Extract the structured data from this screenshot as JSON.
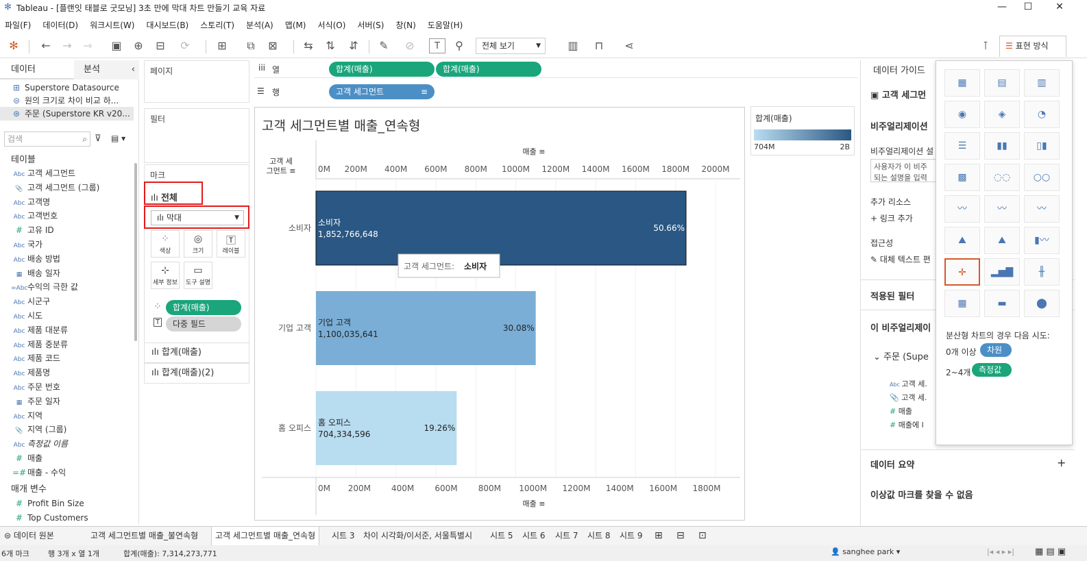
{
  "window": {
    "title": "Tableau - [플랜잇 태블로 굿모닝] 3초 만에 막대 차트 만들기 교육 자료"
  },
  "menu": [
    "파일(F)",
    "데이터(D)",
    "워크시트(W)",
    "대시보드(B)",
    "스토리(T)",
    "분석(A)",
    "맵(M)",
    "서식(O)",
    "서버(S)",
    "창(N)",
    "도움말(H)"
  ],
  "toolbar": {
    "view_select": "전체 보기",
    "show_me": "표현 방식"
  },
  "left": {
    "tab_data": "데이터",
    "tab_analysis": "분석",
    "sources": [
      "Superstore Datasource",
      "원의 크기로 차이 비교 하...",
      "주문 (Superstore KR v20..."
    ],
    "search_placeholder": "검색",
    "tables_header": "테이블",
    "fields": [
      {
        "icon": "Abc",
        "name": "고객 세그먼트"
      },
      {
        "icon": "📎",
        "name": "고객 세그먼트 (그룹)"
      },
      {
        "icon": "Abc",
        "name": "고객명"
      },
      {
        "icon": "Abc",
        "name": "고객번호"
      },
      {
        "icon": "#",
        "name": "고유 ID"
      },
      {
        "icon": "Abc",
        "name": "국가"
      },
      {
        "icon": "Abc",
        "name": "배송 방법"
      },
      {
        "icon": "▦",
        "name": "배송 일자"
      },
      {
        "icon": "=Abc",
        "name": "수익의 극한 값"
      },
      {
        "icon": "Abc",
        "name": "시군구"
      },
      {
        "icon": "Abc",
        "name": "시도"
      },
      {
        "icon": "Abc",
        "name": "제품 대분류"
      },
      {
        "icon": "Abc",
        "name": "제품 중분류"
      },
      {
        "icon": "Abc",
        "name": "제품 코드"
      },
      {
        "icon": "Abc",
        "name": "제품명"
      },
      {
        "icon": "Abc",
        "name": "주문 번호"
      },
      {
        "icon": "▦",
        "name": "주문 일자"
      },
      {
        "icon": "Abc",
        "name": "지역"
      },
      {
        "icon": "📎",
        "name": "지역 (그룹)"
      },
      {
        "icon": "Abc",
        "name": "측정값 이름"
      },
      {
        "icon": "#",
        "name": "매출"
      },
      {
        "icon": "=#",
        "name": "매출 - 수익"
      }
    ],
    "params_header": "매개 변수",
    "params": [
      "Profit Bin Size",
      "Top Customers"
    ]
  },
  "shelves": {
    "pages": "페이지",
    "filters": "필터",
    "marks": "마크",
    "marks_all": "전체",
    "mark_type": "막대",
    "buttons": [
      "색상",
      "크기",
      "레이블",
      "세부 정보",
      "도구 설명"
    ],
    "pill_color": "합계(매출)",
    "pill_multi": "다중 필드",
    "sub1": "합계(매출)",
    "sub2": "합계(매출)(2)"
  },
  "columns_label": "열",
  "rows_label": "행",
  "columns_pills": [
    "합계(매출)",
    "합계(매출)"
  ],
  "rows_pills": [
    "고객 세그먼트"
  ],
  "chart_data": {
    "type": "bar",
    "title": "고객 세그먼트별 매출_연속형",
    "row_header": "고객 세 그먼트",
    "xlabel": "매출",
    "categories": [
      "소비자",
      "기업 고객",
      "홈 오피스"
    ],
    "values": [
      1852766648,
      1100035641,
      704334596
    ],
    "value_labels": [
      "1,852,766,648",
      "1,100,035,641",
      "704,334,596"
    ],
    "percent_labels": [
      "50.66%",
      "30.08%",
      "19.26%"
    ],
    "top_ticks": [
      "0M",
      "200M",
      "400M",
      "600M",
      "800M",
      "1000M",
      "1200M",
      "1400M",
      "1600M",
      "1800M",
      "2000M"
    ],
    "bottom_ticks": [
      "0M",
      "200M",
      "400M",
      "600M",
      "800M",
      "1000M",
      "1200M",
      "1400M",
      "1600M",
      "1800M"
    ],
    "colors": [
      "#2a5783",
      "#7aaed6",
      "#b8dcf0"
    ],
    "tooltip": {
      "key": "고객 세그먼트:",
      "value": "소비자"
    }
  },
  "legend": {
    "title": "합계(매출)",
    "min": "704M",
    "max": "2B"
  },
  "right": {
    "title": "데이터 가이드",
    "field": "고객 세그먼",
    "viz_header": "비주얼리제이션",
    "viz_desc_label": "비주얼리제이션 설",
    "viz_desc": "사용자가 이 비주 되는 설명을 입력",
    "resources": "추가 리소스",
    "add_link": "링크 추가",
    "access": "접근성",
    "alt_text": "대체 텍스트 편",
    "filters": "적용된 필터",
    "this_viz": "이 비주얼리제이",
    "source": "주문 (Supe",
    "fields": [
      "고객 세.",
      "고객 세.",
      "매출",
      "매출에 l"
    ],
    "summary": "데이터 요약",
    "outliers": "이상값 마크를 찾을 수 없음"
  },
  "showme": {
    "hint": "분산형 차트의 경우 다음 시도:",
    "row1_label": "0개 이상",
    "row1_pill": "차원",
    "row2_label": "2~4개",
    "row2_pill": "측정값"
  },
  "tabs": [
    "데이터 원본",
    "고객 세그먼트별 매출_불연속형",
    "고객 세그먼트별 매출_연속형",
    "시트 3",
    "차이 시각화/이서준, 서울특별시",
    "시트 5",
    "시트 6",
    "시트 7",
    "시트 8",
    "시트 9"
  ],
  "status": {
    "marks": "6개 마크",
    "rows": "행 3개 x 열 1개",
    "sum": "합계(매출): 7,314,273,771",
    "user": "sanghee park"
  }
}
